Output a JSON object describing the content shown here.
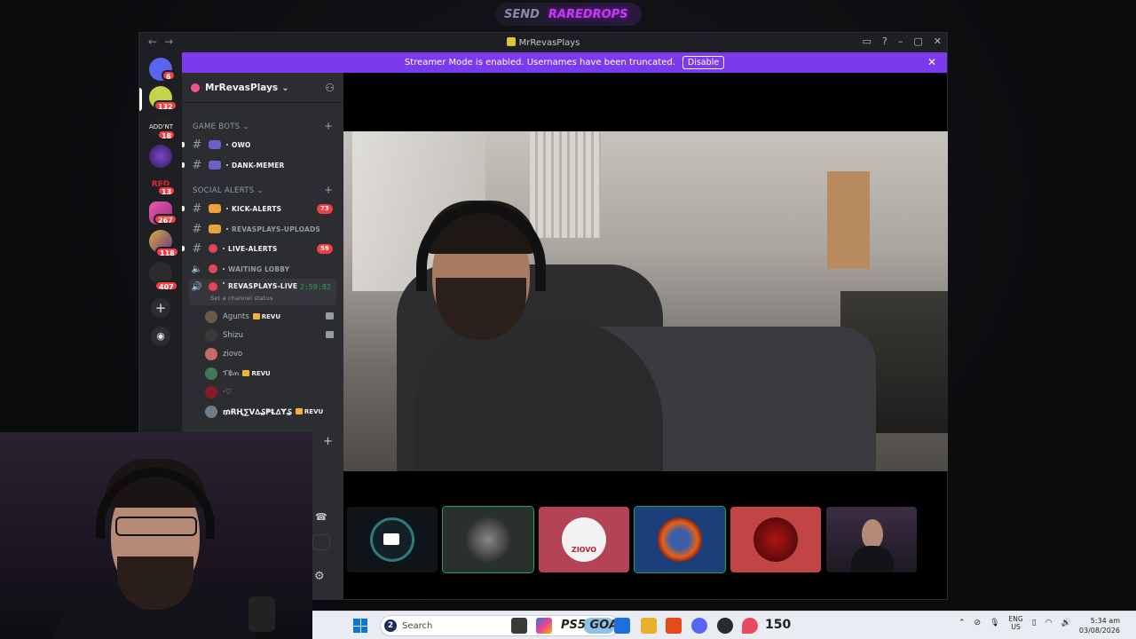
{
  "overlay": {
    "send": "SEND",
    "rare": "RAREDROPS"
  },
  "window": {
    "title": "MrRevasPlays"
  },
  "banner": {
    "text": "Streamer Mode is enabled. Usernames have been truncated.",
    "disable": "Disable"
  },
  "rail": {
    "badges": [
      "6",
      "132",
      "18",
      "13",
      "267",
      "118",
      "407"
    ],
    "red_logo": "RED",
    "addicts_logo": "ADD'NT"
  },
  "server": {
    "name": "MrRevasPlays",
    "chevron": "⌄"
  },
  "categories": {
    "game_bots": "GAME BOTS",
    "social_alerts": "SOCIAL ALERTS"
  },
  "channels": {
    "owo": "OWO",
    "dank": "DANK-MEMER",
    "kick": "KICK-ALERTS",
    "kick_count": "73",
    "uploads": "REVASPLAYS-UPLOADS",
    "live": "LIVE-ALERTS",
    "live_count": "59",
    "lobby": "WAITING LOBBY",
    "voice": "REVASPLAYS-LIVE",
    "voice_time": "2:59:02",
    "voice_status": "Set a channel status"
  },
  "voice_users": [
    {
      "name": "Agunts",
      "tag": "REVU"
    },
    {
      "name": "Shizu",
      "tag": ""
    },
    {
      "name": "ziovo",
      "tag": ""
    },
    {
      "name": "ፕ฿ጠ",
      "tag": "REVU"
    },
    {
      "name": "·♡",
      "tag": ""
    },
    {
      "name": "₥ɌⱧ∑V∆₷₱Ⱡ∆Ɏ₷",
      "tag": "REVU"
    }
  ],
  "tiles": [
    "camera-tile",
    "joker-avatar",
    "ziovo-avatar",
    "fire-avatar",
    "red-demon-avatar",
    "streamer-webcam"
  ],
  "tile_text": {
    "ziovo": "ZIOVO"
  },
  "taskbar": {
    "search": "Search",
    "search_badge": "2",
    "ps5": "PS5 GOAL",
    "counter": "150",
    "lang_top": "ENG",
    "lang_bottom": "US",
    "time": "5:34 am",
    "date": "03/08/2026"
  },
  "colors": {
    "accent": "#7c3aed",
    "badge": "#f23f43",
    "online": "#23a559"
  }
}
